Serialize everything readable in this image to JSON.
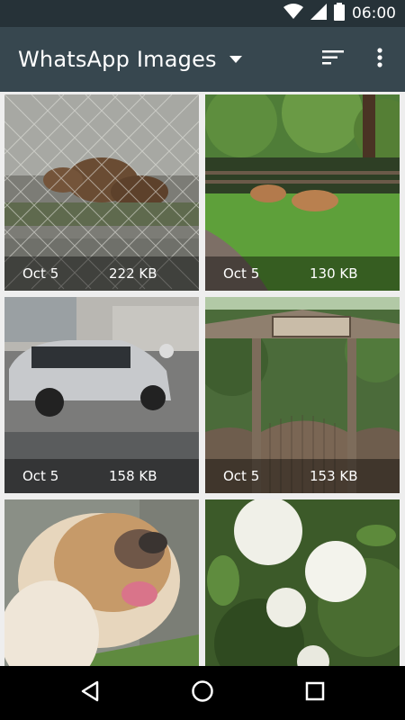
{
  "status_bar": {
    "time": "06:00",
    "icons": [
      "wifi-icon",
      "signal-icon",
      "battery-icon"
    ]
  },
  "toolbar": {
    "title": "WhatsApp Images",
    "dropdown_icon": "dropdown-arrow-icon",
    "sort_icon": "sort-icon",
    "overflow_icon": "more-vert-icon"
  },
  "grid": {
    "items": [
      {
        "subject": "boars",
        "date": "Oct 5",
        "size": "222 KB"
      },
      {
        "subject": "deer",
        "date": "Oct 5",
        "size": "130 KB"
      },
      {
        "subject": "car",
        "date": "Oct 5",
        "size": "158 KB"
      },
      {
        "subject": "gate",
        "date": "Oct 5",
        "size": "153 KB"
      },
      {
        "subject": "bulldog",
        "date": "",
        "size": ""
      },
      {
        "subject": "flowers",
        "date": "",
        "size": ""
      }
    ]
  },
  "nav_bar": {
    "icons": [
      "back-icon",
      "home-icon",
      "recents-icon"
    ]
  },
  "colors": {
    "status_bar_bg": "#263238",
    "toolbar_bg": "#37474f",
    "grid_bg": "#eeeeee",
    "nav_bar_bg": "#000000"
  }
}
